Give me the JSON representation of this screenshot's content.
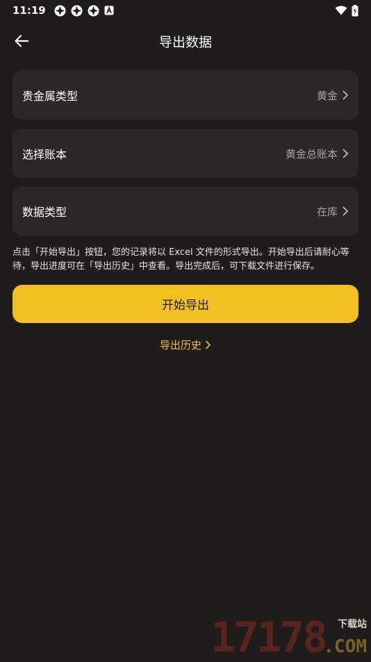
{
  "status_bar": {
    "time": "11:19",
    "left_icons": [
      "app-notification-icon",
      "app-notification-icon",
      "app-notification-icon",
      "keyboard-a-icon"
    ],
    "right_icons": [
      "wifi-icon",
      "battery-icon"
    ]
  },
  "header": {
    "back_icon": "arrow-left-icon",
    "title": "导出数据"
  },
  "settings": [
    {
      "label": "贵金属类型",
      "value": "黄金"
    },
    {
      "label": "选择账本",
      "value": "黄金总账本"
    },
    {
      "label": "数据类型",
      "value": "在库"
    }
  ],
  "description": "点击「开始导出」按钮，您的记录将以 Excel 文件的形式导出。开始导出后请耐心等待，导出进度可在「导出历史」中查看。导出完成后，可下载文件进行保存。",
  "export_button_label": "开始导出",
  "history_link_label": "导出历史",
  "watermark": {
    "digits": "17178",
    "site": "下载站",
    "domain": ".COM"
  },
  "colors": {
    "background": "#1e1d1c",
    "card": "#2b2927",
    "accent": "#f0c01f",
    "muted_text": "#a9a6a1"
  }
}
